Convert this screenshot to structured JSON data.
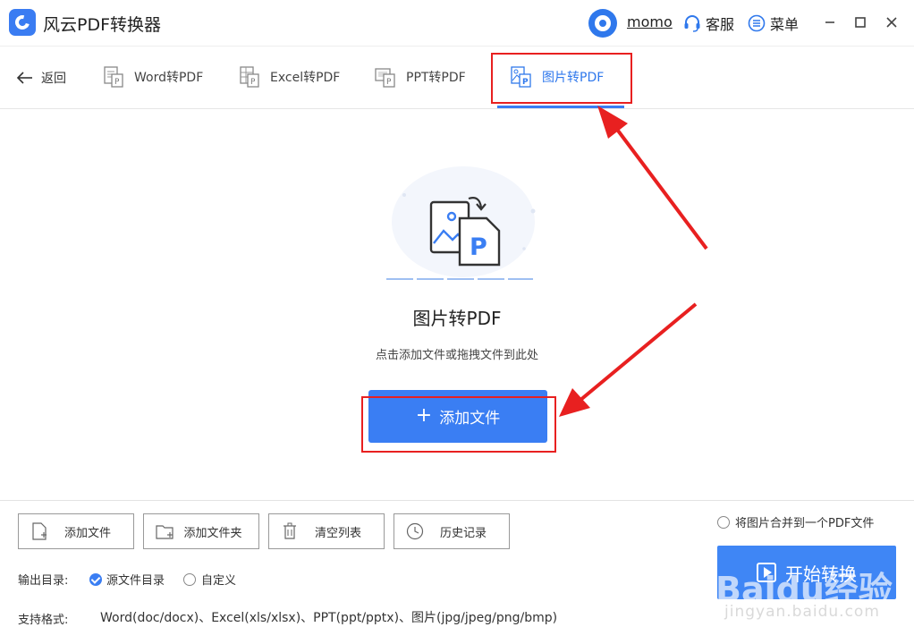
{
  "app": {
    "title": "风云PDF转换器"
  },
  "user": {
    "name": "momo"
  },
  "header": {
    "service_label": "客服",
    "menu_label": "菜单"
  },
  "tabs": {
    "back_label": "返回",
    "items": [
      {
        "label": "Word转PDF",
        "active": false
      },
      {
        "label": "Excel转PDF",
        "active": false
      },
      {
        "label": "PPT转PDF",
        "active": false
      },
      {
        "label": "图片转PDF",
        "active": true
      }
    ]
  },
  "main": {
    "title": "图片转PDF",
    "subtitle": "点击添加文件或拖拽文件到此处",
    "add_button_label": "添加文件"
  },
  "bottom": {
    "buttons": [
      {
        "label": "添加文件"
      },
      {
        "label": "添加文件夹"
      },
      {
        "label": "清空列表"
      },
      {
        "label": "历史记录"
      }
    ],
    "merge_label": "将图片合并到一个PDF文件",
    "merge_checked": false,
    "start_label": "开始转换",
    "output_label": "输出目录:",
    "output_options": [
      {
        "label": "源文件目录",
        "checked": true
      },
      {
        "label": "自定义",
        "checked": false
      }
    ],
    "formats_label": "支持格式:",
    "formats_value": "Word(doc/docx)、Excel(xls/xlsx)、PPT(ppt/pptx)、图片(jpg/jpeg/png/bmp)"
  },
  "colors": {
    "accent": "#3a7ef3",
    "highlight": "#e82020"
  },
  "watermark": {
    "text": "Baidu经验",
    "sub": "jingyan.baidu.com"
  }
}
